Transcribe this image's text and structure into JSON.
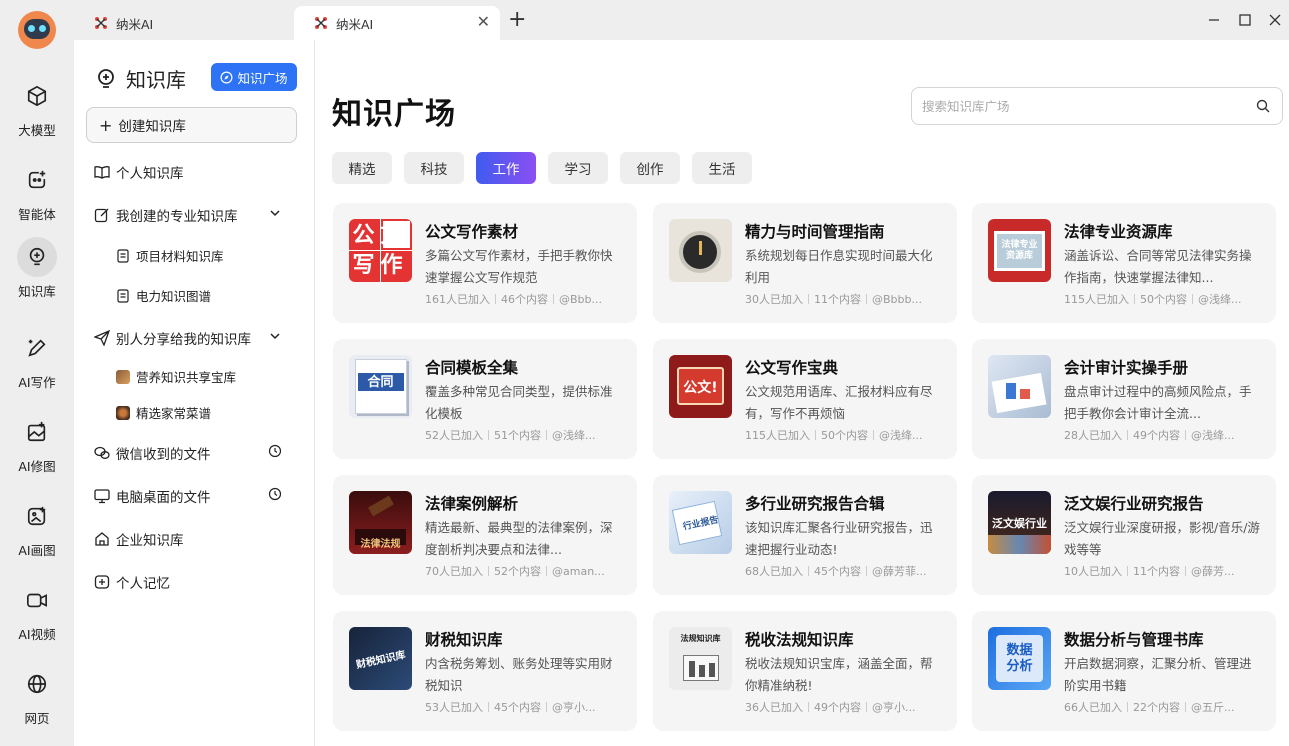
{
  "tabs": [
    {
      "label": "纳米AI"
    },
    {
      "label": "纳米AI"
    }
  ],
  "rail": {
    "items": [
      {
        "label": "大模型",
        "icon": "cube-icon"
      },
      {
        "label": "智能体",
        "icon": "agent-icon"
      },
      {
        "label": "知识库",
        "icon": "bulb-icon"
      },
      {
        "label": "AI写作",
        "icon": "pen-icon"
      },
      {
        "label": "AI修图",
        "icon": "image-edit-icon"
      },
      {
        "label": "AI画图",
        "icon": "paint-icon"
      },
      {
        "label": "AI视频",
        "icon": "video-icon"
      },
      {
        "label": "网页",
        "icon": "globe-icon"
      }
    ]
  },
  "sidebar": {
    "title": "知识库",
    "plaza_button": "知识广场",
    "create_button": "创建知识库",
    "personal": "个人知识库",
    "my_created": "我创建的专业知识库",
    "my_created_items": [
      "项目材料知识库",
      "电力知识图谱"
    ],
    "shared": "别人分享给我的知识库",
    "shared_items": [
      "营养知识共享宝库",
      "精选家常菜谱"
    ],
    "wechat": "微信收到的文件",
    "desktop": "电脑桌面的文件",
    "enterprise": "企业知识库",
    "memory": "个人记忆"
  },
  "main": {
    "title": "知识广场",
    "search_placeholder": "搜索知识库广场",
    "categories": [
      "精选",
      "科技",
      "工作",
      "学习",
      "创作",
      "生活"
    ],
    "active_category": "工作",
    "cards": [
      {
        "title": "公文写作素材",
        "desc": "多篇公文写作素材，手把手教你快速掌握公文写作规范",
        "joined": "161人已加入",
        "contents": "46个内容",
        "author": "@Bbb...",
        "cover_text": "公文写作"
      },
      {
        "title": "精力与时间管理指南",
        "desc": "系统规划每日作息实现时间最大化利用",
        "joined": "30人已加入",
        "contents": "11个内容",
        "author": "@Bbbb...",
        "cover_text": ""
      },
      {
        "title": "法律专业资源库",
        "desc": "涵盖诉讼、合同等常见法律实务操作指南，快速掌握法律知...",
        "joined": "115人已加入",
        "contents": "50个内容",
        "author": "@浅绛...",
        "cover_text": "法律专业资源库"
      },
      {
        "title": "合同模板全集",
        "desc": "覆盖多种常见合同类型，提供标准化模板",
        "joined": "52人已加入",
        "contents": "51个内容",
        "author": "@浅绛...",
        "cover_text": "合同"
      },
      {
        "title": "公文写作宝典",
        "desc": "公文规范用语库、汇报材料应有尽有，写作不再烦恼",
        "joined": "115人已加入",
        "contents": "50个内容",
        "author": "@浅绛...",
        "cover_text": "公文!"
      },
      {
        "title": "会计审计实操手册",
        "desc": "盘点审计过程中的高频风险点，手把手教你会计审计全流...",
        "joined": "28人已加入",
        "contents": "49个内容",
        "author": "@浅绛...",
        "cover_text": ""
      },
      {
        "title": "法律案例解析",
        "desc": "精选最新、最典型的法律案例，深度剖析判决要点和法律...",
        "joined": "70人已加入",
        "contents": "52个内容",
        "author": "@aman...",
        "cover_text": "法律法规"
      },
      {
        "title": "多行业研究报告合辑",
        "desc": "该知识库汇聚各行业研究报告，迅速把握行业动态!",
        "joined": "68人已加入",
        "contents": "45个内容",
        "author": "@薛芳菲...",
        "cover_text": "行业报告"
      },
      {
        "title": "泛文娱行业研究报告",
        "desc": "泛文娱行业深度研报，影视/音乐/游戏等等",
        "joined": "10人已加入",
        "contents": "11个内容",
        "author": "@薛芳...",
        "cover_text": "泛文娱行业"
      },
      {
        "title": "财税知识库",
        "desc": "内含税务筹划、账务处理等实用财税知识",
        "joined": "53人已加入",
        "contents": "45个内容",
        "author": "@亨小...",
        "cover_text": "财税知识库"
      },
      {
        "title": "税收法规知识库",
        "desc": "税收法规知识宝库，涵盖全面，帮你精准纳税!",
        "joined": "36人已加入",
        "contents": "49个内容",
        "author": "@亨小...",
        "cover_text": "法规知识库"
      },
      {
        "title": "数据分析与管理书库",
        "desc": "开启数据洞察，汇聚分析、管理进阶实用书籍",
        "joined": "66人已加入",
        "contents": "22个内容",
        "author": "@五斤...",
        "cover_text": "数据分析"
      }
    ]
  },
  "colors": {
    "accent": "#2e73f6",
    "chip_gradient_start": "#3f5bf0",
    "chip_gradient_end": "#8b4ff2"
  }
}
